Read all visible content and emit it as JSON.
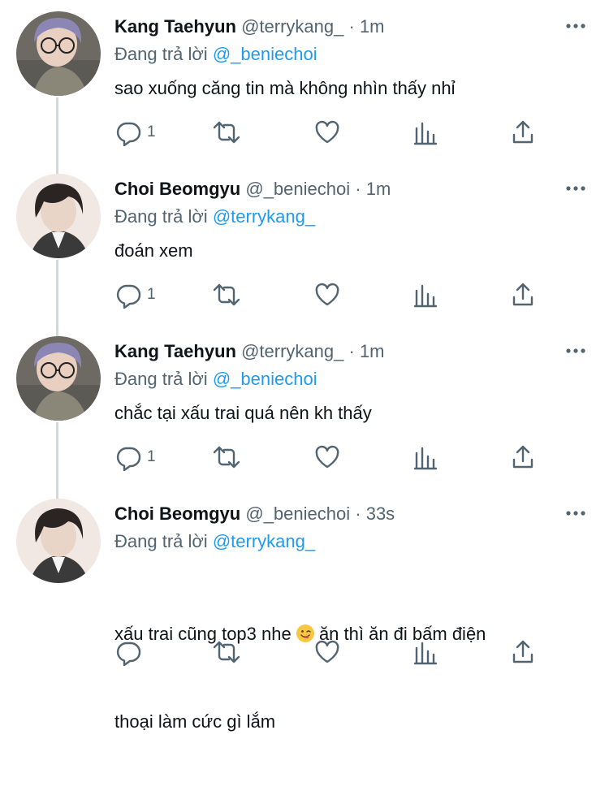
{
  "tweets": [
    {
      "name": "Kang Taehyun",
      "handle": "@terrykang_",
      "time": "1m",
      "reply_prefix": "Đang trả lời",
      "reply_to": "@_beniechoi",
      "text": "sao xuống căng tin mà không nhìn thấy nhỉ",
      "reply_count": "1",
      "avatar": "hoodie-glasses-avatar"
    },
    {
      "name": "Choi Beomgyu",
      "handle": "@_beniechoi",
      "time": "1m",
      "reply_prefix": "Đang trả lời",
      "reply_to": "@terrykang_",
      "text": "đoán xem",
      "reply_count": "1",
      "avatar": "dark-hair-avatar"
    },
    {
      "name": "Kang Taehyun",
      "handle": "@terrykang_",
      "time": "1m",
      "reply_prefix": "Đang trả lời",
      "reply_to": "@_beniechoi",
      "text": "chắc tại xấu trai quá nên kh thấy",
      "reply_count": "1",
      "avatar": "hoodie-glasses-avatar"
    },
    {
      "name": "Choi Beomgyu",
      "handle": "@_beniechoi",
      "time": "33s",
      "reply_prefix": "Đang trả lời",
      "reply_to": "@terrykang_",
      "text_before_emoji": "xấu trai cũng top3 nhe ",
      "emoji": "yum-face-emoji",
      "text_after_emoji": " ăn thì ăn đi bấm điện",
      "text_line2": "thoại làm cức gì lắm",
      "reply_count": "",
      "avatar": "dark-hair-avatar"
    }
  ],
  "separator": "·",
  "colors": {
    "text": "#0f1419",
    "secondary": "#536471",
    "mention": "#1d9bf0",
    "thread_line": "#cfd9de"
  }
}
